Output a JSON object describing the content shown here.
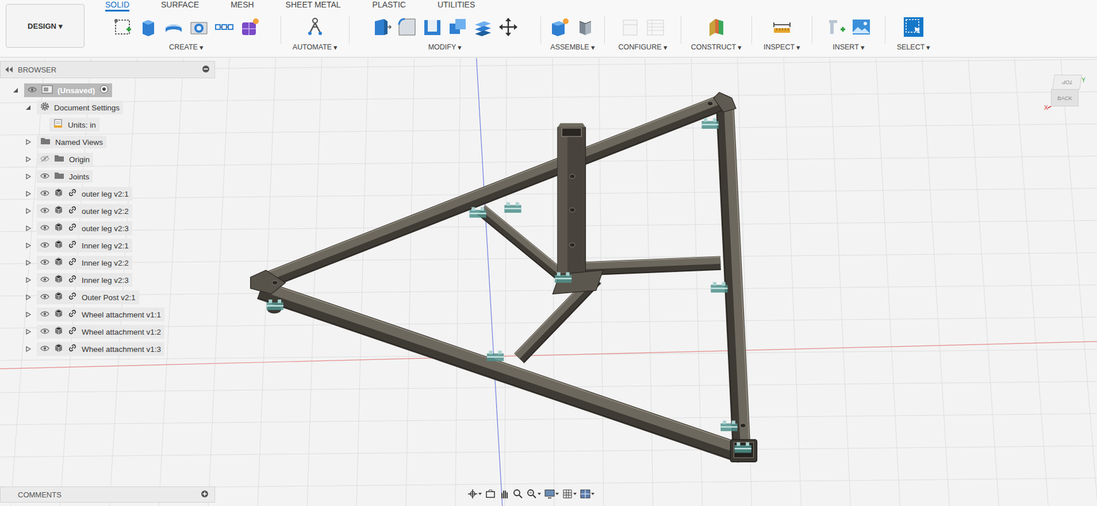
{
  "design_menu": {
    "label": "DESIGN",
    "caret": "▾"
  },
  "tabs": [
    {
      "label": "SOLID",
      "selected": true
    },
    {
      "label": "SURFACE",
      "selected": false
    },
    {
      "label": "MESH",
      "selected": false
    },
    {
      "label": "SHEET METAL",
      "selected": false
    },
    {
      "label": "PLASTIC",
      "selected": false
    },
    {
      "label": "UTILITIES",
      "selected": false
    }
  ],
  "tool_groups": [
    {
      "label": "CREATE",
      "caret": "▾"
    },
    {
      "label": "AUTOMATE",
      "caret": "▾"
    },
    {
      "label": "MODIFY",
      "caret": "▾"
    },
    {
      "label": "ASSEMBLE",
      "caret": "▾"
    },
    {
      "label": "CONFIGURE",
      "caret": "▾"
    },
    {
      "label": "CONSTRUCT",
      "caret": "▾"
    },
    {
      "label": "INSPECT",
      "caret": "▾"
    },
    {
      "label": "INSERT",
      "caret": "▾"
    },
    {
      "label": "SELECT",
      "caret": "▾"
    }
  ],
  "browser": {
    "title": "BROWSER",
    "items": [
      {
        "label": "(Unsaved)",
        "kind": "root",
        "depth": 0,
        "expanded": true,
        "visible": true,
        "selected": true
      },
      {
        "label": "Document Settings",
        "kind": "settings",
        "depth": 1,
        "expanded": true,
        "selected": false
      },
      {
        "label": "Units: in",
        "kind": "units",
        "depth": 2,
        "selected": false
      },
      {
        "label": "Named Views",
        "kind": "folder",
        "depth": 1,
        "expanded": false,
        "selected": false
      },
      {
        "label": "Origin",
        "kind": "folder",
        "depth": 1,
        "expanded": false,
        "visible": false,
        "selected": false
      },
      {
        "label": "Joints",
        "kind": "folder",
        "depth": 1,
        "expanded": false,
        "visible": true,
        "selected": false
      },
      {
        "label": "outer leg v2:1",
        "kind": "component",
        "depth": 1,
        "expanded": false,
        "visible": true,
        "selected": false
      },
      {
        "label": "outer leg v2:2",
        "kind": "component",
        "depth": 1,
        "expanded": false,
        "visible": true,
        "selected": false
      },
      {
        "label": "outer leg v2:3",
        "kind": "component",
        "depth": 1,
        "expanded": false,
        "visible": true,
        "selected": false
      },
      {
        "label": "Inner leg v2:1",
        "kind": "component",
        "depth": 1,
        "expanded": false,
        "visible": true,
        "selected": false
      },
      {
        "label": "Inner leg v2:2",
        "kind": "component",
        "depth": 1,
        "expanded": false,
        "visible": true,
        "selected": false
      },
      {
        "label": "Inner leg v2:3",
        "kind": "component",
        "depth": 1,
        "expanded": false,
        "visible": true,
        "selected": false
      },
      {
        "label": "Outer Post v2:1",
        "kind": "component",
        "depth": 1,
        "expanded": false,
        "visible": true,
        "selected": false
      },
      {
        "label": "Wheel attachment v1:1",
        "kind": "component",
        "depth": 1,
        "expanded": false,
        "visible": true,
        "selected": false
      },
      {
        "label": "Wheel attachment v1:2",
        "kind": "component",
        "depth": 1,
        "expanded": false,
        "visible": true,
        "selected": false
      },
      {
        "label": "Wheel attachment v1:3",
        "kind": "component",
        "depth": 1,
        "expanded": false,
        "visible": true,
        "selected": false
      }
    ]
  },
  "comments": {
    "title": "COMMENTS"
  },
  "viewcube": {
    "top": "TOP",
    "front": "BACK",
    "x_axis": "X",
    "y_axis": "Y"
  }
}
